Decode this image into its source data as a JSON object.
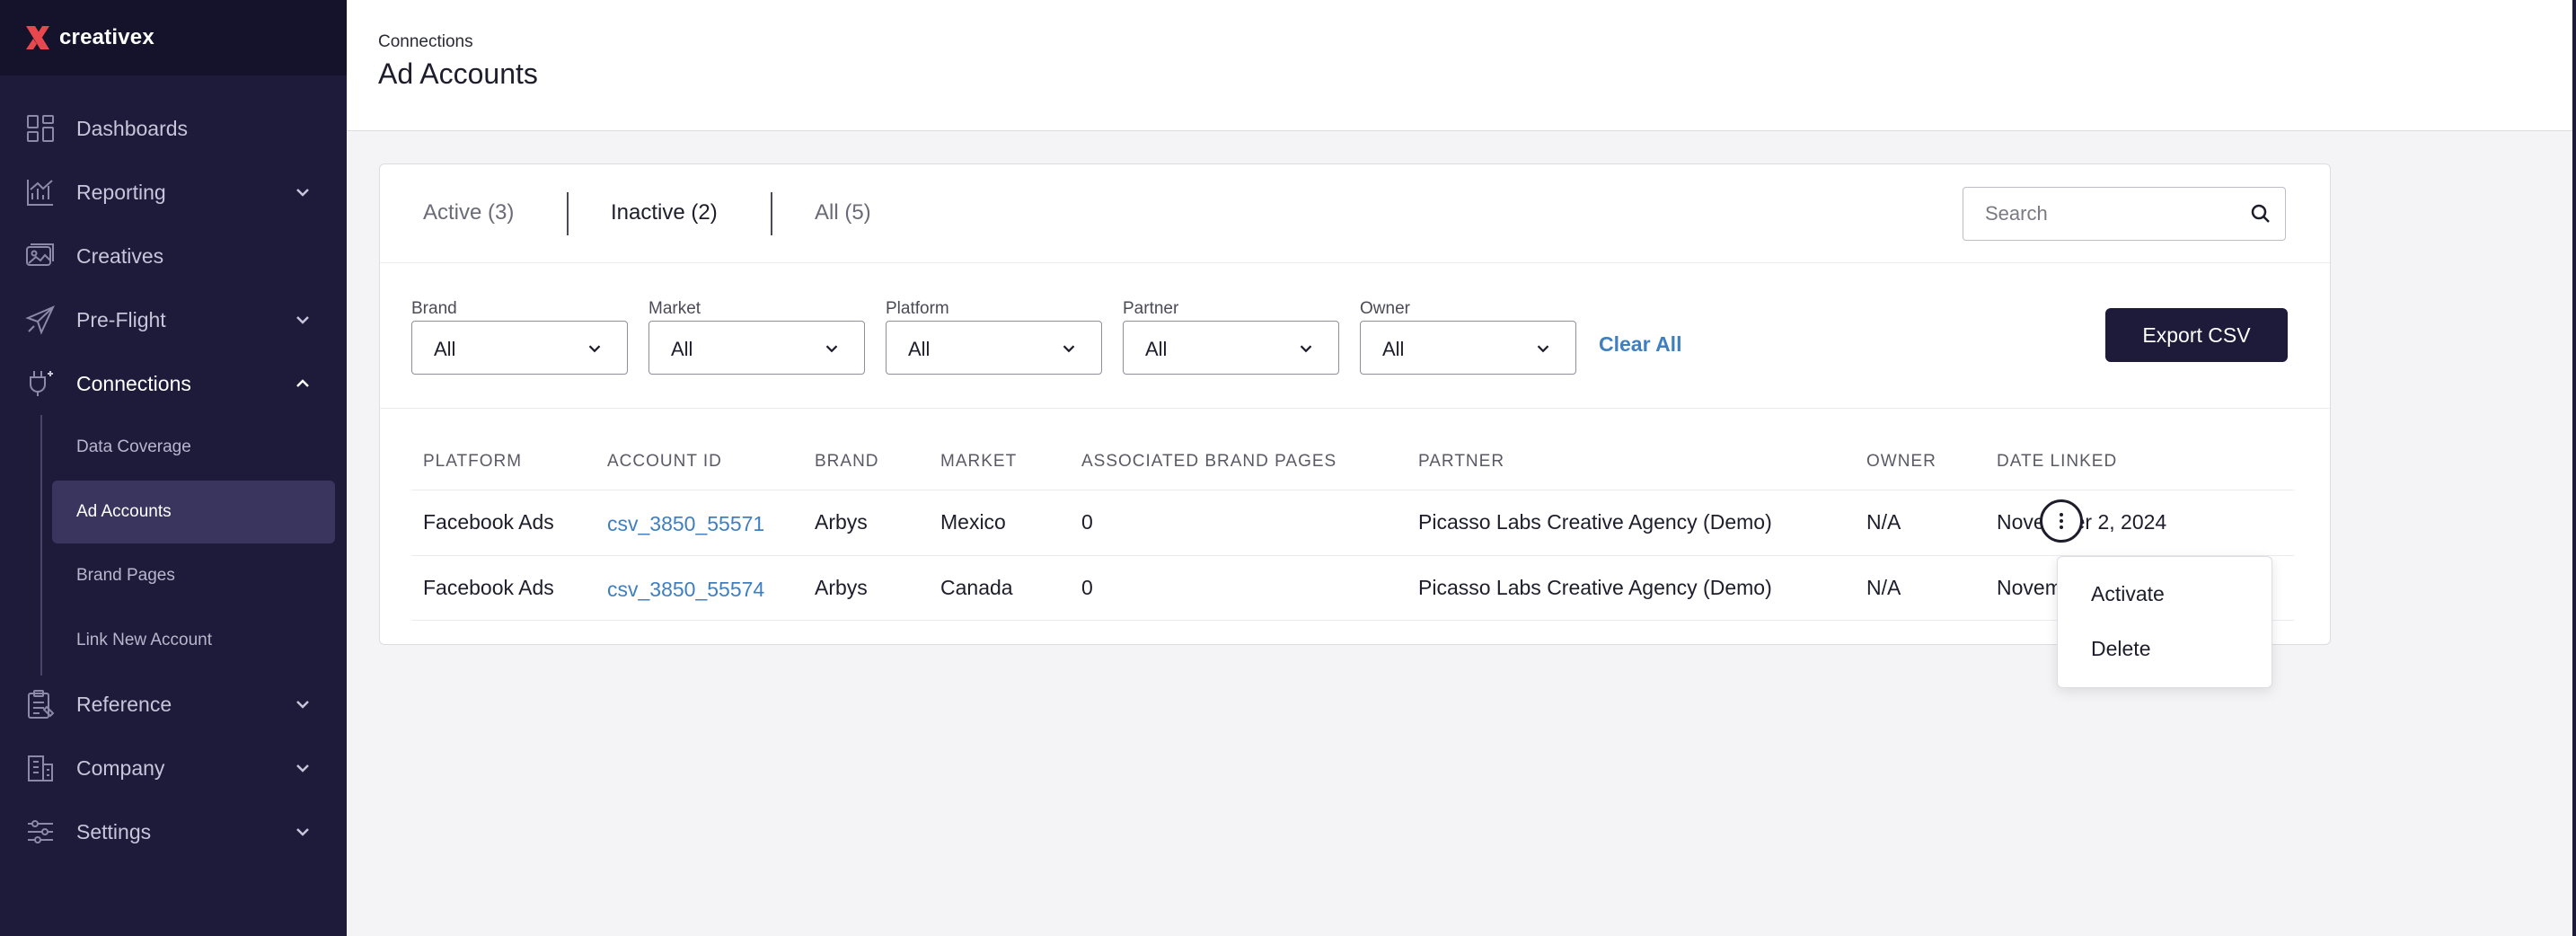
{
  "app": {
    "logo_text": "creativex",
    "brand_color": "#e8484d"
  },
  "sidebar": {
    "items": [
      {
        "label": "Dashboards",
        "icon": "dashboard-grid-icon",
        "has_chevron": false
      },
      {
        "label": "Reporting",
        "icon": "reporting-chart-icon",
        "has_chevron": true
      },
      {
        "label": "Creatives",
        "icon": "creatives-image-icon",
        "has_chevron": false
      },
      {
        "label": "Pre-Flight",
        "icon": "paper-plane-icon",
        "has_chevron": true
      },
      {
        "label": "Connections",
        "icon": "plug-icon",
        "has_chevron": true,
        "expanded": true
      },
      {
        "label": "Reference",
        "icon": "clipboard-icon",
        "has_chevron": true
      },
      {
        "label": "Company",
        "icon": "building-icon",
        "has_chevron": true
      },
      {
        "label": "Settings",
        "icon": "sliders-icon",
        "has_chevron": true
      }
    ],
    "connections_subitems": [
      {
        "label": "Data Coverage",
        "active": false
      },
      {
        "label": "Ad Accounts",
        "active": true
      },
      {
        "label": "Brand Pages",
        "active": false
      },
      {
        "label": "Link New Account",
        "active": false
      }
    ]
  },
  "header": {
    "breadcrumb": "Connections",
    "title": "Ad Accounts"
  },
  "tabs": [
    {
      "label": "Active (3)",
      "active": false
    },
    {
      "label": "Inactive (2)",
      "active": true
    },
    {
      "label": "All (5)",
      "active": false
    }
  ],
  "search": {
    "placeholder": "Search",
    "value": ""
  },
  "filters": [
    {
      "label": "Brand",
      "value": "All"
    },
    {
      "label": "Market",
      "value": "All"
    },
    {
      "label": "Platform",
      "value": "All"
    },
    {
      "label": "Partner",
      "value": "All"
    },
    {
      "label": "Owner",
      "value": "All"
    }
  ],
  "clear_all_label": "Clear All",
  "export_label": "Export CSV",
  "table": {
    "columns": [
      "PLATFORM",
      "ACCOUNT ID",
      "BRAND",
      "MARKET",
      "ASSOCIATED BRAND PAGES",
      "PARTNER",
      "OWNER",
      "DATE LINKED"
    ],
    "rows": [
      {
        "platform": "Facebook Ads",
        "account_id": "csv_3850_55571",
        "brand": "Arbys",
        "market": "Mexico",
        "pages": "0",
        "partner": "Picasso Labs Creative Agency (Demo)",
        "owner": "N/A",
        "date": "November 2, 2024"
      },
      {
        "platform": "Facebook Ads",
        "account_id": "csv_3850_55574",
        "brand": "Arbys",
        "market": "Canada",
        "pages": "0",
        "partner": "Picasso Labs Creative Agency (Demo)",
        "owner": "N/A",
        "date": "Novem"
      }
    ]
  },
  "row_menu": {
    "items": [
      "Activate",
      "Delete"
    ]
  }
}
